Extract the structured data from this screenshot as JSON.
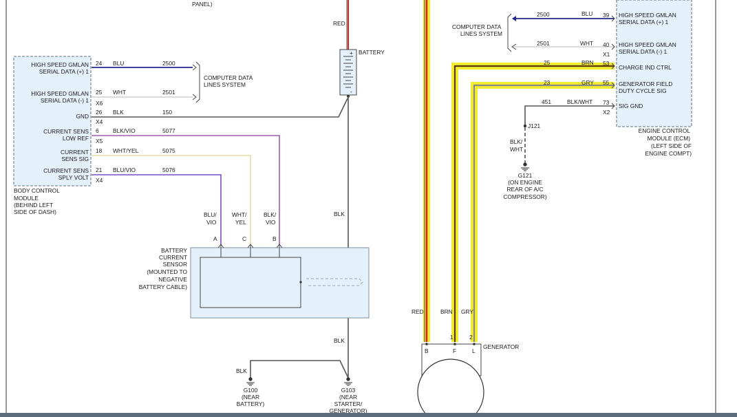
{
  "panel_top": "PANEL)",
  "colors": {
    "red": "#e11b1b",
    "blue": "#1f2a8a",
    "white_wire": "#d6d6d6",
    "black": "#555555",
    "violet": "#7a4fbf",
    "purple": "#a35bb3",
    "tan": "#e8dca6",
    "brown": "#5a3a12",
    "gray": "#8a8a8a",
    "highlight": "#f2ec2e",
    "module_fill": "#e4f1fa",
    "module_border": "#7d8fa0"
  },
  "bcm": {
    "pins": [
      {
        "name1": "HIGH SPEED GMLAN",
        "name2": "SERIAL DATA (+) 1",
        "num": "24",
        "color": "BLU",
        "circuit": "2500",
        "conn": ""
      },
      {
        "name1": "HIGH SPEED GMLAN",
        "name2": "SERIAL DATA (-) 1",
        "num": "25",
        "color": "WHT",
        "circuit": "2501",
        "conn": "X6"
      },
      {
        "name1": "",
        "name2": "GND",
        "num": "26",
        "color": "BLK",
        "circuit": "150",
        "conn": "X4"
      },
      {
        "name1": "CURRENT SENS",
        "name2": "LOW REF",
        "num": "6",
        "color": "BLK/VIO",
        "circuit": "5077",
        "conn": "X5"
      },
      {
        "name1": "CURRENT",
        "name2": "SENS SIG",
        "num": "18",
        "color": "WHT/YEL",
        "circuit": "5075",
        "conn": ""
      },
      {
        "name1": "CURRENT SENS",
        "name2": "SPLY VOLT",
        "num": "21",
        "color": "BLU/VIO",
        "circuit": "5076",
        "conn": "X4"
      }
    ],
    "label": [
      "BODY CONTROL",
      "MODULE",
      "(BEHIND LEFT",
      "SIDE OF DASH)"
    ],
    "cdls": [
      "COMPUTER DATA",
      "LINES SYSTEM"
    ]
  },
  "battery": {
    "top_wire": "RED",
    "label": "BATTERY",
    "plus": "+",
    "minus": "-",
    "down_wire": "BLK",
    "down_wire2": "BLK"
  },
  "sensor": {
    "wires": [
      {
        "color1": "BLU/",
        "color2": "VIO",
        "pin": "A"
      },
      {
        "color1": "WHT/",
        "color2": "YEL",
        "pin": "C"
      },
      {
        "color1": "BLK/",
        "color2": "VIO",
        "pin": "B"
      }
    ],
    "label": [
      "BATTERY",
      "CURRENT",
      "SENSOR",
      "(MOUNTED TO",
      "NEGATIVE",
      "BATTERY CABLE)"
    ]
  },
  "grounds": {
    "g100": {
      "wire": "BLK",
      "name": "G100",
      "loc": [
        "(NEAR",
        "BATTERY)"
      ]
    },
    "g103": {
      "name": "G103",
      "loc": [
        "(NEAR",
        "STARTER/",
        "GENERATOR)"
      ]
    },
    "g121": {
      "splice": "J121",
      "wire": [
        "BLK/",
        "WHT"
      ],
      "name": "G121",
      "loc": [
        "(ON ENGINE",
        "REAR OF A/C",
        "COMPRESSOR)"
      ]
    }
  },
  "ecm": {
    "cdls": [
      "COMPUTER DATA",
      "LINES SYSTEM"
    ],
    "pins": [
      {
        "name1": "HIGH SPEED GMLAN",
        "name2": "SERIAL DATA (+) 1",
        "num": "39",
        "color": "BLU",
        "circuit": "2500",
        "conn": ""
      },
      {
        "name1": "HIGH SPEED GMLAN",
        "name2": "SERIAL DATA (-) 1",
        "num": "40",
        "color": "WHT",
        "circuit": "2501",
        "conn": "X1"
      },
      {
        "name1": "",
        "name2": "CHARGE IND CTRL",
        "num": "53",
        "color": "BRN",
        "circuit": "25",
        "conn": ""
      },
      {
        "name1": "GENERATOR FIELD",
        "name2": "DUTY CYCLE SIG",
        "num": "55",
        "color": "GRY",
        "circuit": "23",
        "conn": ""
      },
      {
        "name1": "",
        "name2": "SIG GND",
        "num": "73",
        "color": "BLK/WHT",
        "circuit": "451",
        "conn": "X2"
      }
    ],
    "label": [
      "ENGINE CONTROL",
      "MODULE (ECM)",
      "(LEFT SIDE OF",
      "ENGINE COMPT)"
    ]
  },
  "generator": {
    "wires": [
      "RED",
      "BRN",
      "GRY"
    ],
    "pin_nums": [
      "1",
      "2"
    ],
    "terms": [
      "B",
      "F",
      "L"
    ],
    "label": "GENERATOR"
  }
}
